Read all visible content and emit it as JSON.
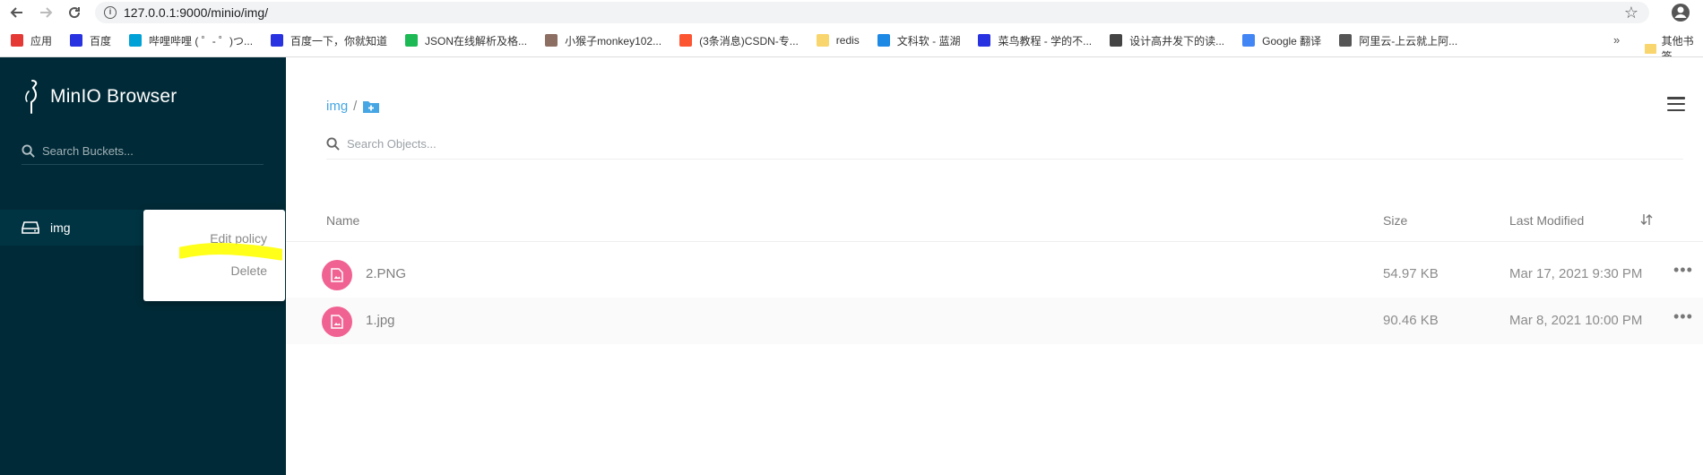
{
  "browser": {
    "url": "127.0.0.1:9000/minio/img/",
    "bookmarks": [
      {
        "label": "应用",
        "icon": "apps-grid-icon",
        "color": "#e53935"
      },
      {
        "label": "百度",
        "icon": "baidu-paw-icon",
        "color": "#2932e1"
      },
      {
        "label": "哔哩哔哩 ( ゜- ゜)つ...",
        "icon": "bilibili-tv-icon",
        "color": "#00a1d6"
      },
      {
        "label": "百度一下，你就知道",
        "icon": "baidu-paw-icon",
        "color": "#2932e1"
      },
      {
        "label": "JSON在线解析及格...",
        "icon": "json-icon",
        "color": "#1db954"
      },
      {
        "label": "小猴子monkey102...",
        "icon": "monkey-avatar-icon",
        "color": "#8d6e63"
      },
      {
        "label": "(3条消息)CSDN-专...",
        "icon": "csdn-c-icon",
        "color": "#fc5531"
      },
      {
        "label": "redis",
        "icon": "folder-icon",
        "color": "#f9d56e"
      },
      {
        "label": "文科软 - 蓝湖",
        "icon": "lanhu-icon",
        "color": "#1e88e5"
      },
      {
        "label": "菜鸟教程 - 学的不...",
        "icon": "baidu-paw-icon",
        "color": "#2932e1"
      },
      {
        "label": "设计高井发下的读...",
        "icon": "design-icon",
        "color": "#444444"
      },
      {
        "label": "Google 翻译",
        "icon": "google-translate-icon",
        "color": "#4285f4"
      },
      {
        "label": "阿里云-上云就上阿...",
        "icon": "globe-icon",
        "color": "#555555"
      }
    ],
    "more_bookmarks": "»",
    "other_bookmarks": "其他书签"
  },
  "sidebar": {
    "brand": "MinIO Browser",
    "search_placeholder": "Search Buckets...",
    "buckets": [
      {
        "name": "img"
      }
    ],
    "bucket_menu": {
      "edit_policy": "Edit policy",
      "delete": "Delete"
    },
    "highlight_color": "#ffff00"
  },
  "main": {
    "breadcrumb": {
      "bucket": "img",
      "separator": "/"
    },
    "search_placeholder": "Search Objects...",
    "columns": {
      "name": "Name",
      "size": "Size",
      "last_modified": "Last Modified"
    },
    "objects": [
      {
        "name": "2.PNG",
        "size": "54.97 KB",
        "last_modified": "Mar 17, 2021 9:30 PM"
      },
      {
        "name": "1.jpg",
        "size": "90.46 KB",
        "last_modified": "Mar 8, 2021 10:00 PM"
      }
    ],
    "row_more": "•••"
  },
  "colors": {
    "sidebar_bg": "#002a37",
    "accent_blue": "#46a6e4",
    "file_icon_pink": "#f06292"
  }
}
